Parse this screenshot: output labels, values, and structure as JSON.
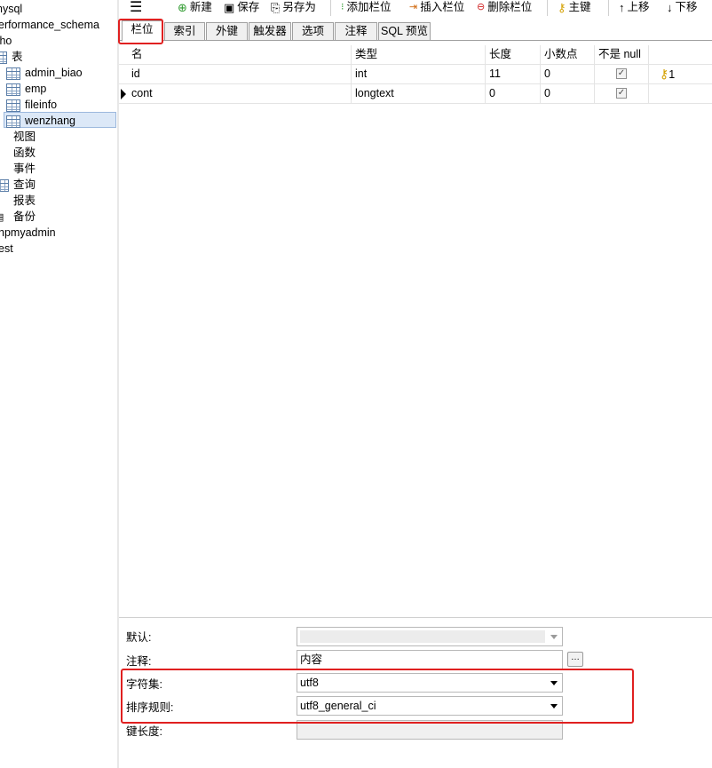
{
  "sidebar": {
    "items": [
      {
        "label": "nysql",
        "icon": "none"
      },
      {
        "label": "erformance_schema",
        "icon": "none"
      },
      {
        "label": "tho",
        "icon": "none"
      },
      {
        "label": "表",
        "icon": "tables-folder-icon"
      },
      {
        "label": "admin_biao",
        "icon": "table-icon"
      },
      {
        "label": "emp",
        "icon": "table-icon"
      },
      {
        "label": "fileinfo",
        "icon": "table-icon"
      },
      {
        "label": "wenzhang",
        "icon": "table-icon"
      },
      {
        "label": "视图",
        "icon": "views-icon"
      },
      {
        "label": "函数",
        "icon": "functions-icon"
      },
      {
        "label": "事件",
        "icon": "events-icon"
      },
      {
        "label": "查询",
        "icon": "queries-icon"
      },
      {
        "label": "报表",
        "icon": "reports-icon"
      },
      {
        "label": "备份",
        "icon": "backups-icon"
      },
      {
        "label": "hpmyadmin",
        "icon": "none"
      },
      {
        "label": "est",
        "icon": "none"
      }
    ]
  },
  "toolbar": {
    "menu_icon": "hamburger-menu-icon",
    "buttons": [
      {
        "label": "新建",
        "icon": "new-icon"
      },
      {
        "label": "保存",
        "icon": "save-icon"
      },
      {
        "label": "另存为",
        "icon": "save-as-icon"
      },
      {
        "label": "添加栏位",
        "icon": "add-field-icon"
      },
      {
        "label": "插入栏位",
        "icon": "insert-field-icon"
      },
      {
        "label": "删除栏位",
        "icon": "delete-field-icon"
      },
      {
        "label": "主键",
        "icon": "primary-key-icon"
      },
      {
        "label": "上移",
        "icon": "arrow-up-icon"
      },
      {
        "label": "下移",
        "icon": "arrow-down-icon"
      }
    ]
  },
  "tabs": [
    {
      "label": "栏位",
      "active": true
    },
    {
      "label": "索引",
      "active": false
    },
    {
      "label": "外键",
      "active": false
    },
    {
      "label": "触发器",
      "active": false
    },
    {
      "label": "选项",
      "active": false
    },
    {
      "label": "注释",
      "active": false
    },
    {
      "label": "SQL 预览",
      "active": false
    }
  ],
  "grid": {
    "columns": [
      "名",
      "类型",
      "长度",
      "小数点",
      "不是 null",
      ""
    ],
    "rows": [
      {
        "name": "id",
        "type": "int",
        "length": "11",
        "decimals": "0",
        "not_null": true,
        "key": "1",
        "current": false
      },
      {
        "name": "cont",
        "type": "longtext",
        "length": "0",
        "decimals": "0",
        "not_null": true,
        "key": "",
        "current": true
      }
    ]
  },
  "properties": {
    "default_label": "默认:",
    "default_value": "",
    "comment_label": "注释:",
    "comment_value": "内容",
    "charset_label": "字符集:",
    "charset_value": "utf8",
    "collation_label": "排序规则:",
    "collation_value": "utf8_general_ci",
    "key_length_label": "键长度:",
    "key_length_value": ""
  },
  "colors": {
    "highlight_red": "#e02020",
    "selection_blue": "#dce8f7"
  }
}
